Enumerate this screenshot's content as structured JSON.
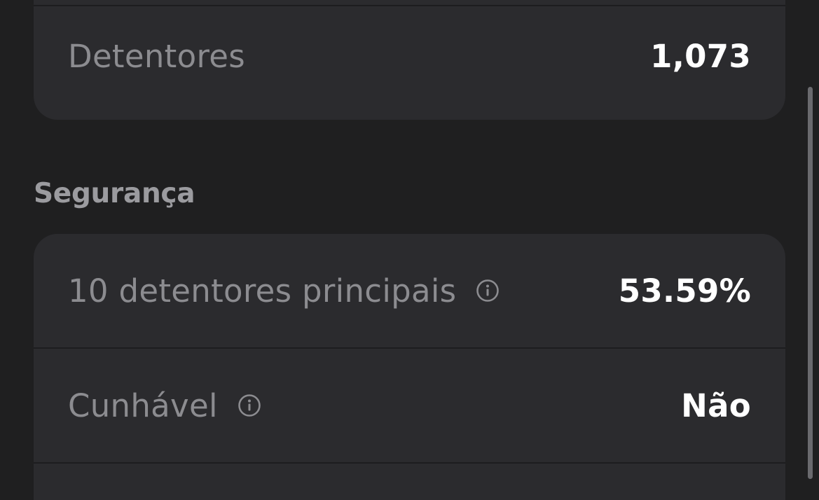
{
  "overview": {
    "holders_label": "Detentores",
    "holders_value": "1,073"
  },
  "security": {
    "title": "Segurança",
    "rows": [
      {
        "label": "10 detentores principais",
        "value": "53.59%",
        "icon": "info-icon"
      },
      {
        "label": "Cunhável",
        "value": "Não",
        "icon": "info-icon"
      }
    ]
  },
  "colors": {
    "background": "#1f1f20",
    "card": "#2b2b2e",
    "label_text": "#8c8c90",
    "value_text": "#ffffff",
    "section_title": "#9b9b9f"
  }
}
